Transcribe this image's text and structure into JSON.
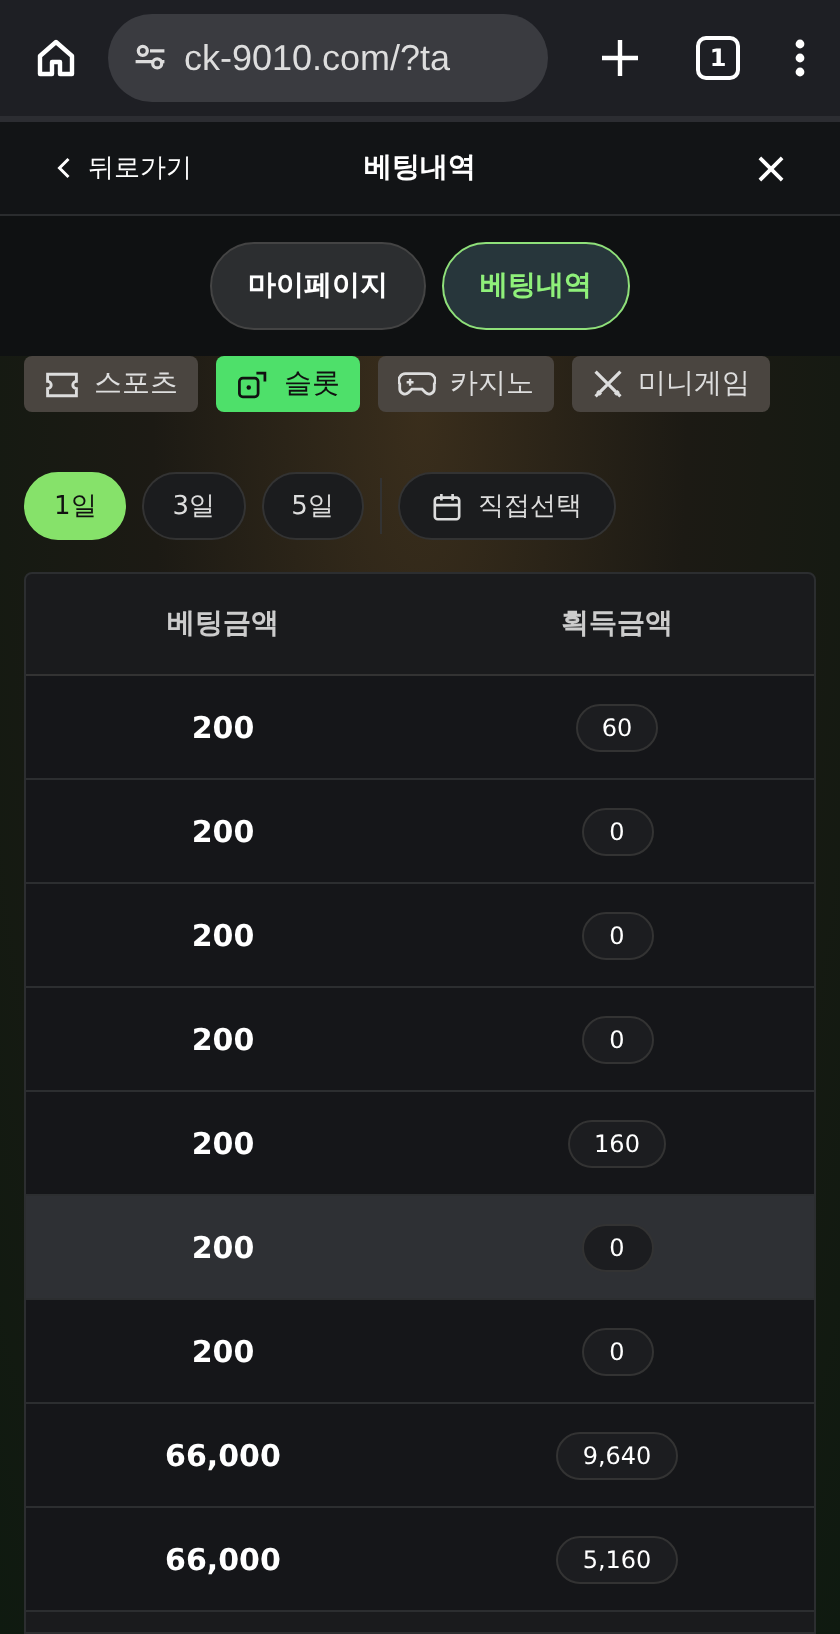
{
  "browser": {
    "url": "ck-9010.com/?ta",
    "tab_count": "1"
  },
  "header": {
    "back": "뒤로가기",
    "title": "베팅내역"
  },
  "tabs": [
    {
      "label": "마이페이지",
      "selected": false
    },
    {
      "label": "베팅내역",
      "selected": true
    }
  ],
  "categories": [
    {
      "label": "스포츠",
      "kind": "ticket",
      "selected": false
    },
    {
      "label": "슬롯",
      "kind": "dice",
      "selected": true
    },
    {
      "label": "카지노",
      "kind": "gamepad",
      "selected": false
    },
    {
      "label": "미니게임",
      "kind": "swords",
      "selected": false
    }
  ],
  "periods": [
    {
      "label": "1일",
      "selected": true
    },
    {
      "label": "3일",
      "selected": false
    },
    {
      "label": "5일",
      "selected": false
    }
  ],
  "custom_range": "직접선택",
  "table": {
    "columns": [
      "베팅금액",
      "획득금액"
    ],
    "rows": [
      {
        "bet": "200",
        "win": "60",
        "highlighted": false
      },
      {
        "bet": "200",
        "win": "0",
        "highlighted": false
      },
      {
        "bet": "200",
        "win": "0",
        "highlighted": false
      },
      {
        "bet": "200",
        "win": "0",
        "highlighted": false
      },
      {
        "bet": "200",
        "win": "160",
        "highlighted": false
      },
      {
        "bet": "200",
        "win": "0",
        "highlighted": true
      },
      {
        "bet": "200",
        "win": "0",
        "highlighted": false
      },
      {
        "bet": "66,000",
        "win": "9,640",
        "highlighted": false
      },
      {
        "bet": "66,000",
        "win": "5,160",
        "highlighted": false
      }
    ]
  }
}
